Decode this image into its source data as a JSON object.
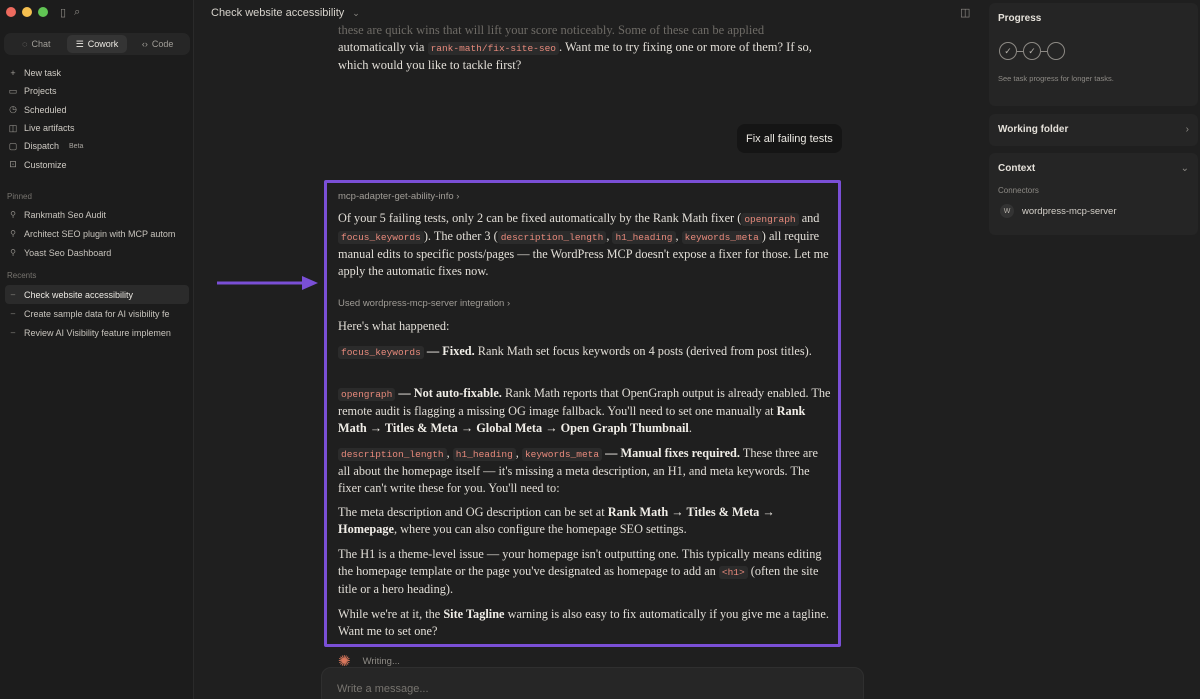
{
  "window": {
    "colors": {
      "close": "#ed6a5e",
      "minimize": "#f5bf4f",
      "maximize": "#61c554"
    }
  },
  "mode_tabs": [
    {
      "label": "Chat",
      "icon": "chat-icon"
    },
    {
      "label": "Cowork",
      "icon": "cowork-icon"
    },
    {
      "label": "Code",
      "icon": "code-icon"
    }
  ],
  "nav": [
    {
      "label": "New task",
      "icon": "plus-icon"
    },
    {
      "label": "Projects",
      "icon": "folder-icon"
    },
    {
      "label": "Scheduled",
      "icon": "clock-icon"
    },
    {
      "label": "Live artifacts",
      "icon": "artifact-icon"
    },
    {
      "label": "Dispatch",
      "icon": "dispatch-icon",
      "badge": "Beta"
    },
    {
      "label": "Customize",
      "icon": "customize-icon"
    }
  ],
  "pinned": {
    "label": "Pinned",
    "items": [
      "Rankmath Seo Audit",
      "Architect SEO plugin with MCP autom",
      "Yoast Seo Dashboard"
    ]
  },
  "recents": {
    "label": "Recents",
    "items": [
      "Check website accessibility",
      "Create sample data for AI visibility fe",
      "Review AI Visibility feature implemen"
    ]
  },
  "header": {
    "title": "Check website accessibility"
  },
  "conversation": {
    "top": {
      "faded": "these are quick wins that will lift your score noticeably. Some of these can be applied",
      "line2_pre": "automatically via ",
      "line2_code": "rank-math/fix-site-seo",
      "line2_post": ". Want me to try fixing one or more of them? If so,",
      "line3": "which would you like to tackle first?"
    },
    "user_message": "Fix all failing tests",
    "tool_call_1": "mcp-adapter-get-ability-info",
    "para1": {
      "t1": "Of your 5 failing tests, only 2 can be fixed automatically by the Rank Math fixer (",
      "c1": "opengraph",
      "t2": " and ",
      "c2": "focus_keywords",
      "t3": "). The other 3 (",
      "c3": "description_length",
      "t4": ", ",
      "c4": "h1_heading",
      "t5": ", ",
      "c5": "keywords_meta",
      "t6": ") all require manual edits to specific posts/pages — the WordPress MCP doesn't expose a fixer for those. Let me apply the automatic fixes now."
    },
    "tool_call_2": "Used wordpress-mcp-server integration",
    "para2": "Here's what happened:",
    "para3": {
      "code": "focus_keywords",
      "bold": " — Fixed.",
      "text": " Rank Math set focus keywords on 4 posts (derived from post titles)."
    },
    "para4": {
      "code": "opengraph",
      "bold": " — Not auto-fixable.",
      "text": " Rank Math reports that OpenGraph output is already enabled. The remote audit is flagging a missing OG image fallback. You'll need to set one manually at ",
      "path": "Rank Math → Titles & Meta → Global Meta → Open Graph Thumbnail",
      "end": "."
    },
    "para5": {
      "c1": "description_length",
      "sep1": ", ",
      "c2": "h1_heading",
      "sep2": ", ",
      "c3": "keywords_meta",
      "bold": " — Manual fixes required.",
      "text": " These three are all about the homepage itself — it's missing a meta description, an H1, and meta keywords. The fixer can't write these for you. You'll need to:"
    },
    "para6": {
      "t1": "The meta description and OG description can be set at ",
      "path": "Rank Math → Titles & Meta → Homepage",
      "t2": ", where you can also configure the homepage SEO settings."
    },
    "para7": {
      "t1": "The H1 is a theme-level issue — your homepage isn't outputting one. This typically means editing the homepage template or the page you've designated as homepage to add an ",
      "code": "<h1>",
      "t2": " (often the site title or a hero heading)."
    },
    "para8": {
      "t1": "While we're at it, the ",
      "bold": "Site Tagline",
      "t2": " warning is also easy to fix automatically if you give me a tagline. Want me to set one?"
    },
    "status": "Writing...",
    "composer_placeholder": "Write a message..."
  },
  "right_panel": {
    "progress_title": "Progress",
    "progress_note": "See task progress for longer tasks.",
    "working_folder_title": "Working folder",
    "context_title": "Context",
    "connectors_label": "Connectors",
    "connector_name": "wordpress-mcp-server",
    "connector_initial": "W"
  },
  "annotation": {
    "highlight_color": "#7a4fd6"
  }
}
